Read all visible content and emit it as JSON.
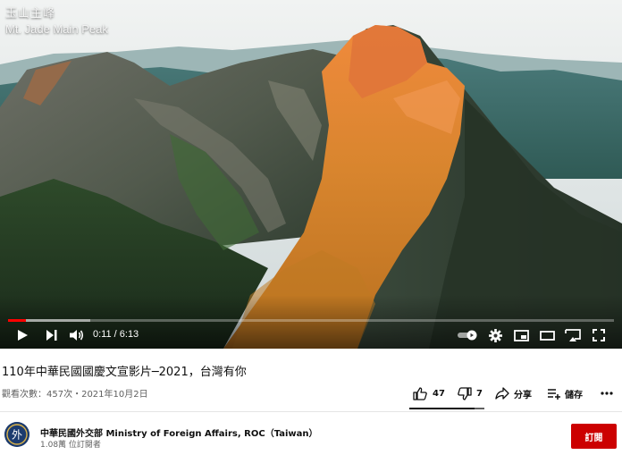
{
  "player": {
    "overlay_title_zh": "玉山主峰",
    "overlay_title_en": "Mt. Jade Main Peak",
    "progress_fraction": 0.0299,
    "buffered_fraction": 0.135,
    "current_time": "0:11",
    "duration": "6:13",
    "time_display": "0:11 / 6:13",
    "controls": [
      "play-icon",
      "next-icon",
      "volume-icon",
      "autoplay-toggle",
      "settings-icon",
      "miniplayer-icon",
      "theater-icon",
      "cast-icon",
      "fullscreen-icon"
    ]
  },
  "video": {
    "title": "110年中華民國國慶文宣影片─2021，台灣有你",
    "meta": "觀看次數：457次・2021年10月2日"
  },
  "actions": {
    "likes": "47",
    "dislikes": "7",
    "share": "分享",
    "save": "儲存"
  },
  "channel": {
    "name": "中華民國外交部 Ministry of Foreign Affairs, ROC（Taiwan）",
    "subscribers": "1.08萬 位訂閱者",
    "avatar_text": "外"
  },
  "subscribe_label": "訂閱",
  "colors": {
    "progress_played": "#ff0000",
    "subscribe_button": "#cc0000",
    "text_primary": "#0f0f0f",
    "text_secondary": "#606060"
  }
}
